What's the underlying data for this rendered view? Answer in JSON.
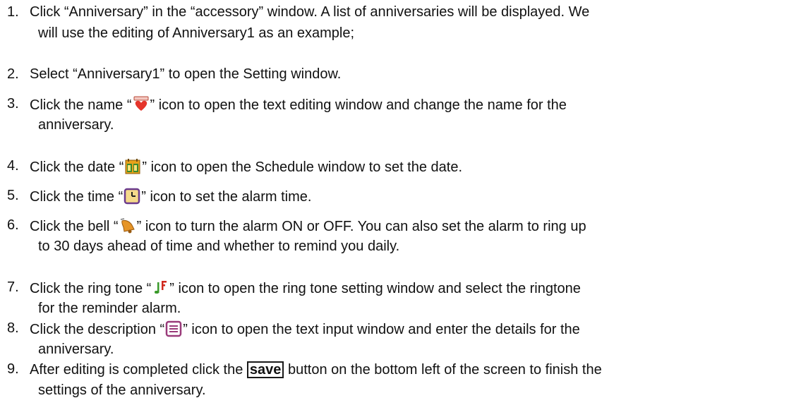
{
  "steps": [
    {
      "number": "1.",
      "line1": "Click “Anniversary” in the “accessory” window. A list of anniversaries will be displayed. We",
      "line2": "will use the editing of Anniversary1 as an example;"
    },
    {
      "number": "2.",
      "line1": "Select “Anniversary1” to open the Setting window."
    },
    {
      "number": "3.",
      "before": "Click the name “",
      "after": "” icon to open the text editing window and change the name for the",
      "line2": "anniversary.",
      "icon": "heart-icon"
    },
    {
      "number": "4.",
      "before": "Click the date “",
      "after": "” icon to open the Schedule window to set the date.",
      "icon": "calendar-icon"
    },
    {
      "number": "5.",
      "before": "Click the time “",
      "after": "” icon to set the alarm time.",
      "icon": "clock-icon"
    },
    {
      "number": "6.",
      "before": "Click the bell “",
      "after": "” icon to turn the alarm ON or OFF. You can also set the alarm to ring up",
      "line2": "to 30 days ahead of time and whether to remind you daily.",
      "icon": "bell-icon"
    },
    {
      "number": "7.",
      "before": "Click the ring tone “",
      "after": "” icon to open the ring tone setting window and select the  ringtone",
      "line2": "for the reminder alarm.",
      "icon": "music-note-icon"
    },
    {
      "number": "8.",
      "before": "Click the description “",
      "after": "” icon to open the text input window and enter the details for the",
      "line2": "anniversary.",
      "icon": "description-icon"
    },
    {
      "number": "9.",
      "before": "After editing is completed click the ",
      "button": "save",
      "after": " button on the bottom left of the screen to finish the",
      "line2": "settings of the anniversary."
    }
  ],
  "colors": {
    "text": "#111111",
    "heart": "#e5352b",
    "calendar": "#e8a21a",
    "clock_border": "#6b3a8c",
    "bell": "#e69528",
    "music_green": "#3a9a2a",
    "music_red": "#d0281e",
    "description": "#9a3b7a"
  }
}
